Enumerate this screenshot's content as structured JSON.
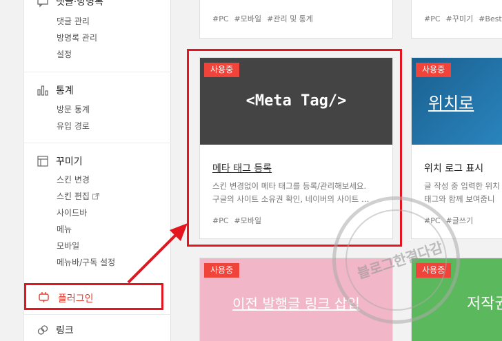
{
  "sidebar": {
    "comments_section": {
      "title": "댓글·방명록",
      "items": [
        "댓글 관리",
        "방명록 관리",
        "설정"
      ]
    },
    "stats_section": {
      "title": "통계",
      "items": [
        "방문 통계",
        "유입 경로"
      ]
    },
    "decorate_section": {
      "title": "꾸미기",
      "items": [
        "스킨 변경",
        "스킨 편집",
        "사이드바",
        "메뉴",
        "모바일",
        "메뉴바/구독 설정"
      ]
    },
    "plugin": {
      "label": "플러그인"
    },
    "link": {
      "label": "링크"
    }
  },
  "cards": {
    "top_left": {
      "tags": [
        "#PC",
        "#모바일",
        "#관리 및 통계"
      ]
    },
    "top_right": {
      "tags": [
        "#PC",
        "#꾸미기",
        "#Best"
      ]
    },
    "meta": {
      "badge": "사용중",
      "thumb_text": "<Meta Tag/>",
      "title": "메타 태그 등록",
      "desc1": "스킨 변경없이 메타 태그를 등록/관리해보세요.",
      "desc2": "구글의 사이트 소유권 확인, 네이버의 사이트 …",
      "tags": [
        "#PC",
        "#모바일"
      ]
    },
    "location": {
      "badge": "사용중",
      "thumb_text": "위치로",
      "title": "위치 로그 표시",
      "desc1": "글 작성 중 입력한 위치",
      "desc2": "태그와 함께 보여줍니",
      "tags": [
        "#PC",
        "#글쓰기"
      ]
    },
    "prev_post": {
      "badge": "사용중",
      "thumb_text": "이전 발행글 링크 삽입"
    },
    "copyright": {
      "badge": "사용중",
      "thumb_text": "저작권"
    }
  },
  "watermark": {
    "text": "블로그한결다감"
  },
  "colors": {
    "accent": "#f0433a",
    "highlight": "#e4151f",
    "meta_bg": "#444444",
    "location_bg": "#1e6fa3",
    "pink_bg": "#f2b6c9",
    "green_bg": "#5cb85c"
  }
}
